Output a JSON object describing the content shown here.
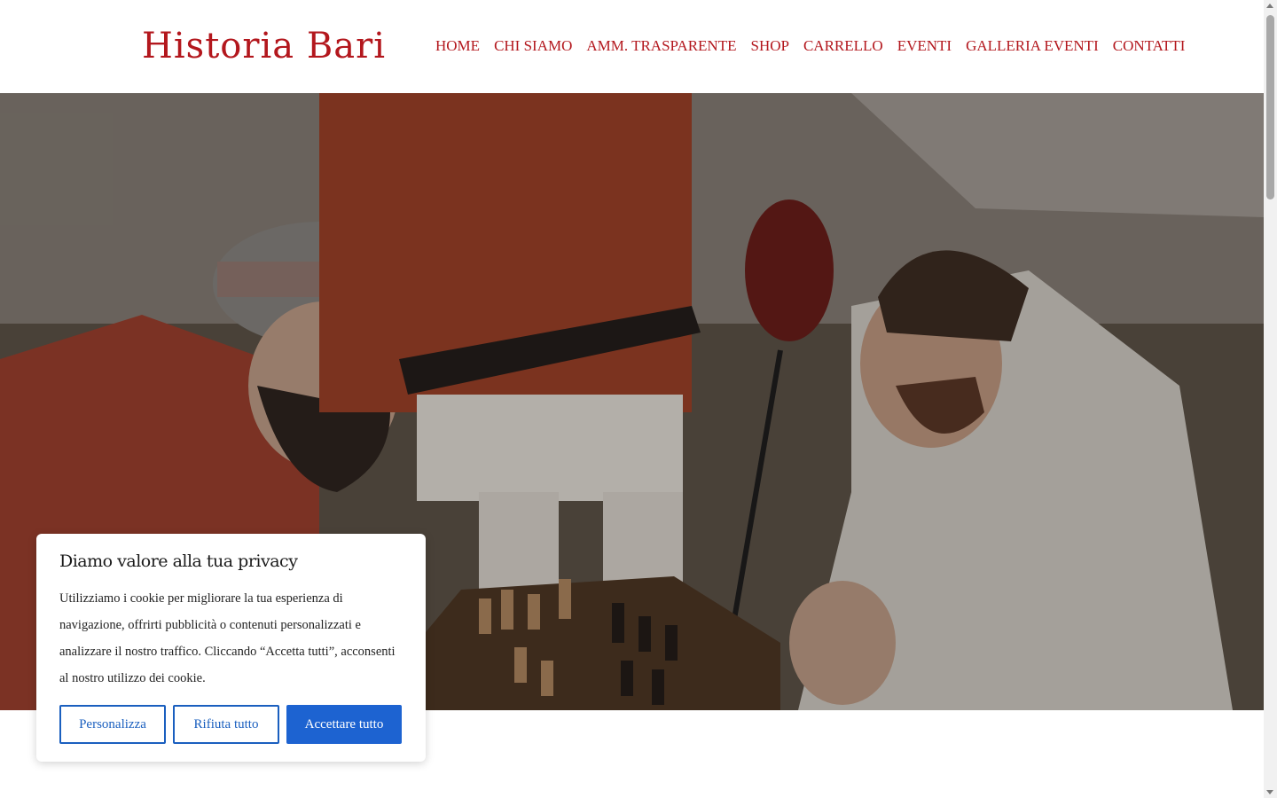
{
  "header": {
    "logo": "Historia Bari",
    "nav": [
      "HOME",
      "CHI SIAMO",
      "AMM. TRASPARENTE",
      "SHOP",
      "CARRELLO",
      "EVENTI",
      "GALLERIA EVENTI",
      "CONTATTI"
    ]
  },
  "cookie_banner": {
    "title": "Diamo valore alla tua privacy",
    "text": "Utilizziamo i cookie per migliorare la tua esperienza di navigazione, offrirti pubblicità o contenuti personalizzati e analizzare il nostro traffico. Cliccando “Accetta tutti”, acconsenti al nostro utilizzo dei cookie.",
    "customize_label": "Personalizza",
    "reject_label": "Rifiuta tutto",
    "accept_label": "Accettare tutto"
  },
  "colors": {
    "brand_red": "#b3171d",
    "button_blue": "#1d63d1"
  }
}
